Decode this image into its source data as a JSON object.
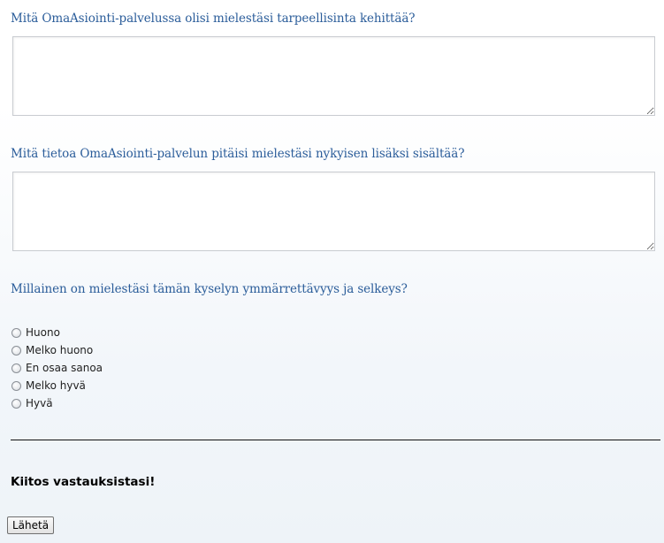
{
  "questions": {
    "q1": {
      "label": "Mitä OmaAsiointi-palvelussa olisi mielestäsi tarpeellisinta kehittää?",
      "value": ""
    },
    "q2": {
      "label": "Mitä tietoa OmaAsiointi-palvelun pitäisi mielestäsi nykyisen lisäksi sisältää?",
      "value": ""
    },
    "q3": {
      "label": "Millainen on mielestäsi tämän kyselyn ymmärrettävyys ja selkeys?",
      "options": [
        "Huono",
        "Melko huono",
        "En osaa sanoa",
        "Melko hyvä",
        "Hyvä"
      ]
    }
  },
  "thanks": "Kiitos vastauksistasi!",
  "submit_label": "Lähetä"
}
